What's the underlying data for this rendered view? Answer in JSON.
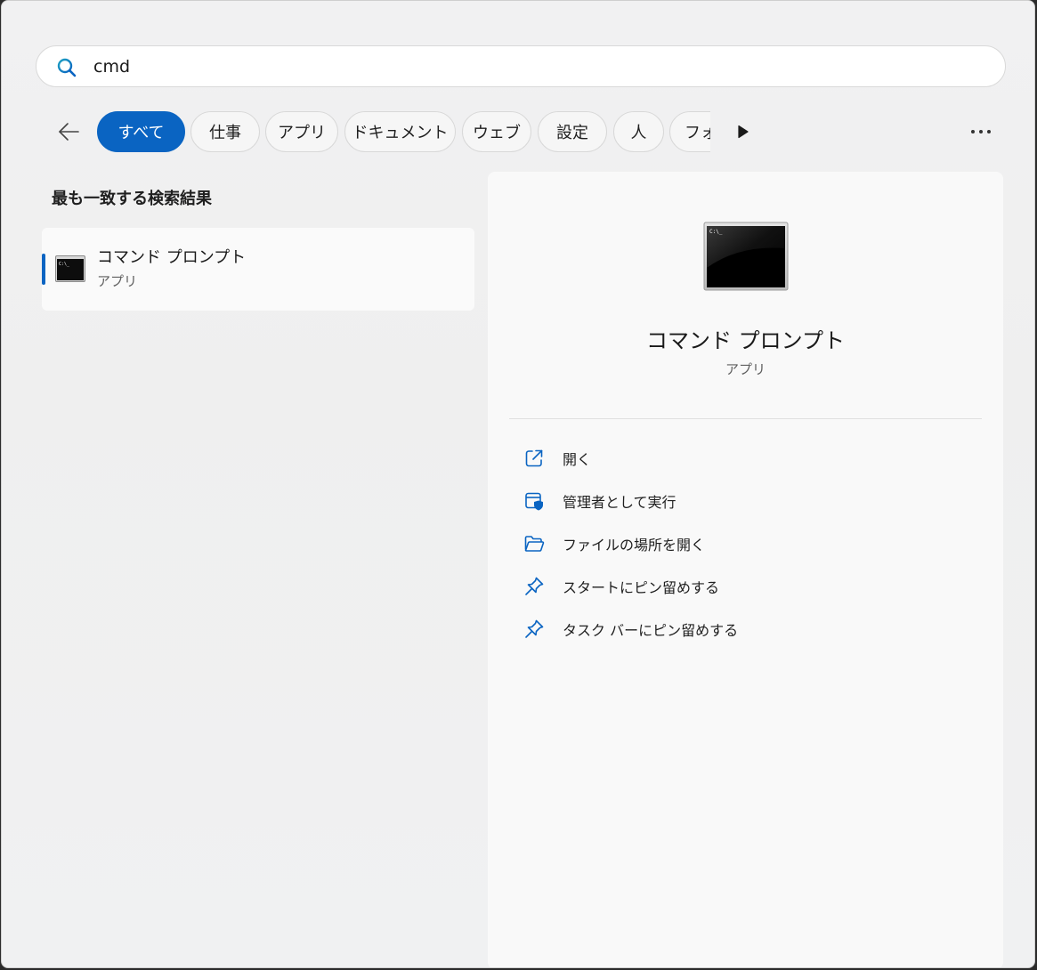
{
  "search": {
    "value": "cmd",
    "icon": "search-icon"
  },
  "filters": {
    "back_icon": "arrow-left-icon",
    "chips": [
      {
        "label": "すべて",
        "active": true
      },
      {
        "label": "仕事"
      },
      {
        "label": "アプリ"
      },
      {
        "label": "ドキュメント"
      },
      {
        "label": "ウェブ"
      },
      {
        "label": "設定"
      },
      {
        "label": "人"
      },
      {
        "label": "フォ"
      }
    ],
    "scroll_icon": "play-right-icon",
    "more_icon": "ellipsis-icon"
  },
  "results": {
    "section_title": "最も一致する検索結果",
    "best_match": {
      "name": "コマンド プロンプト",
      "type": "アプリ",
      "icon": "command-prompt-icon"
    }
  },
  "detail": {
    "name": "コマンド プロンプト",
    "type": "アプリ",
    "actions": [
      {
        "label": "開く",
        "icon": "open-external-icon"
      },
      {
        "label": "管理者として実行",
        "icon": "run-as-admin-shield-icon"
      },
      {
        "label": "ファイルの場所を開く",
        "icon": "folder-open-icon"
      },
      {
        "label": "スタートにピン留めする",
        "icon": "pin-icon"
      },
      {
        "label": "タスク バーにピン留めする",
        "icon": "pin-icon"
      }
    ]
  },
  "colors": {
    "accent": "#0a64c2"
  }
}
